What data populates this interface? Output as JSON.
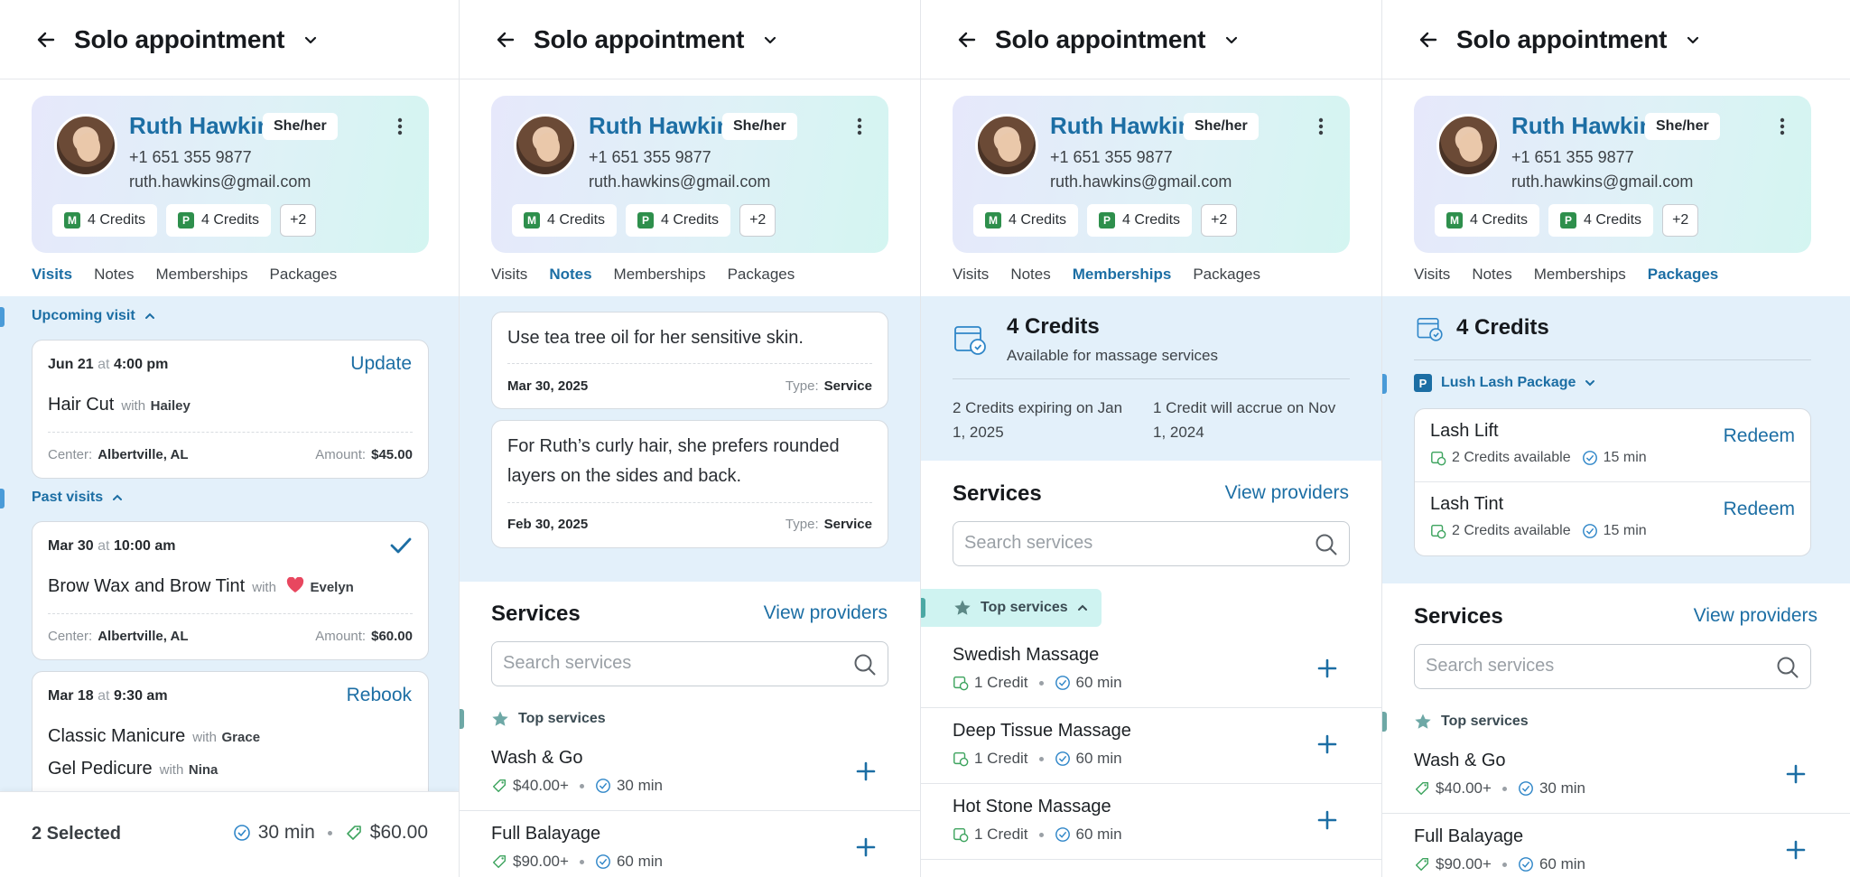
{
  "header": {
    "title": "Solo appointment"
  },
  "profile": {
    "name": "Ruth Hawkins",
    "pronouns": "She/her",
    "phone": "+1 651 355 9877",
    "email": "ruth.hawkins@gmail.com",
    "chips": [
      {
        "badge": "M",
        "label": "4 Credits"
      },
      {
        "badge": "P",
        "label": "4 Credits"
      }
    ],
    "more": "+2"
  },
  "tabs": [
    "Visits",
    "Notes",
    "Memberships",
    "Packages"
  ],
  "visits": {
    "upcoming_label": "Upcoming visit",
    "past_label": "Past visits",
    "upcoming": {
      "date": "Jun 21",
      "at": "at",
      "time": "4:00 pm",
      "action": "Update",
      "service": "Hair Cut",
      "with": "with",
      "provider": "Hailey",
      "center_label": "Center:",
      "center": "Albertville, AL",
      "amount_label": "Amount:",
      "amount": "$45.00"
    },
    "past": [
      {
        "date": "Mar 30",
        "at": "at",
        "time": "10:00 am",
        "service": "Brow Wax and Brow Tint",
        "with": "with",
        "provider": "Evelyn",
        "center_label": "Center:",
        "center": "Albertville, AL",
        "amount_label": "Amount:",
        "amount": "$60.00"
      },
      {
        "date": "Mar 18",
        "at": "at",
        "time": "9:30 am",
        "action": "Rebook",
        "service": "Classic Manicure",
        "with": "with",
        "provider": "Grace",
        "service2": "Gel Pedicure",
        "with2": "with",
        "provider2": "Nina"
      }
    ],
    "footer": {
      "selected": "2 Selected",
      "duration": "30 min",
      "amount": "$60.00"
    }
  },
  "notes": [
    {
      "text": "Use tea tree oil for her sensitive skin.",
      "date": "Mar 30, 2025",
      "type_label": "Type:",
      "type": "Service"
    },
    {
      "text": "For Ruth’s curly hair, she prefers rounded layers on the sides and back.",
      "date": "Feb 30, 2025",
      "type_label": "Type:",
      "type": "Service"
    }
  ],
  "services": {
    "title": "Services",
    "view_providers": "View providers",
    "search_placeholder": "Search services",
    "top_label": "Top services",
    "items": [
      {
        "name": "Wash & Go",
        "price": "$40.00+",
        "duration": "30 min"
      },
      {
        "name": "Full Balayage",
        "price": "$90.00+",
        "duration": "60 min"
      }
    ]
  },
  "memberships": {
    "credits": "4 Credits",
    "sub": "Available for massage services",
    "expiring": "2 Credits expiring on Jan 1, 2025",
    "accrue": "1 Credit will accrue on Nov 1, 2024",
    "services": [
      {
        "name": "Swedish Massage",
        "credit": "1 Credit",
        "duration": "60 min"
      },
      {
        "name": "Deep Tissue Massage",
        "credit": "1 Credit",
        "duration": "60 min"
      },
      {
        "name": "Hot Stone Massage",
        "credit": "1 Credit",
        "duration": "60 min"
      }
    ]
  },
  "packages": {
    "credits": "4 Credits",
    "package_badge": "P",
    "package_name": "Lush Lash Package",
    "items": [
      {
        "name": "Lash Lift",
        "credits": "2 Credits available",
        "duration": "15 min",
        "action": "Redeem"
      },
      {
        "name": "Lash Tint",
        "credits": "2 Credits available",
        "duration": "15 min",
        "action": "Redeem"
      }
    ]
  },
  "colors": {
    "accent": "#1c6ea4",
    "band": "#e3f0fa",
    "heart": "#e8475f",
    "badge_green": "#2e8f4c"
  }
}
